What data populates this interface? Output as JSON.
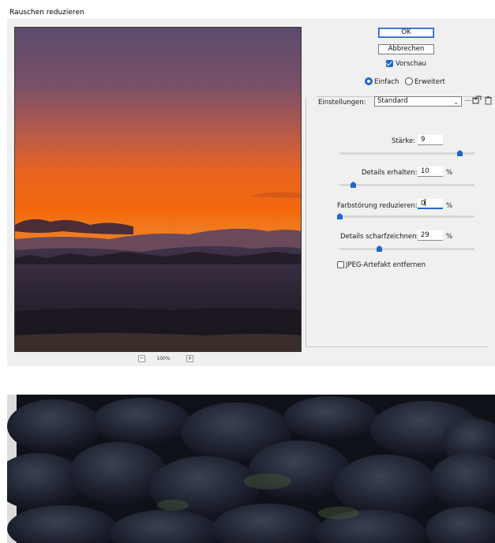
{
  "window": {
    "title": "Rauschen reduzieren"
  },
  "preview": {
    "zoom_minus": "−",
    "zoom_level": "100%",
    "zoom_plus": "+"
  },
  "buttons": {
    "ok": "OK",
    "cancel": "Abbrechen"
  },
  "preview_check": {
    "label": "Vorschau",
    "checked": true
  },
  "mode": {
    "simple": "Einfach",
    "advanced": "Erweitert",
    "selected": "simple"
  },
  "settings": {
    "label": "Einstellungen:",
    "value": "Standard",
    "save_icon": "save-preset-icon",
    "delete_icon": "trash-icon"
  },
  "sliders": [
    {
      "label": "Stärke:",
      "value": "9",
      "unit": "",
      "level": 0.9
    },
    {
      "label": "Details erhalten:",
      "value": "10",
      "unit": "%",
      "level": 0.1
    },
    {
      "label": "Farbstörung reduzieren:",
      "value": "0",
      "unit": "%",
      "level": 0.0
    },
    {
      "label": "Details scharfzeichnen:",
      "value": "29",
      "unit": "%",
      "level": 0.29
    }
  ],
  "jpeg_check": {
    "label": "JPEG-Artefakt entfernen",
    "checked": false
  },
  "colors": {
    "accent": "#1f66d1",
    "sky_top": "#5a4b6e",
    "sky_glow": "#f26a0c",
    "land": "#2b2230"
  }
}
